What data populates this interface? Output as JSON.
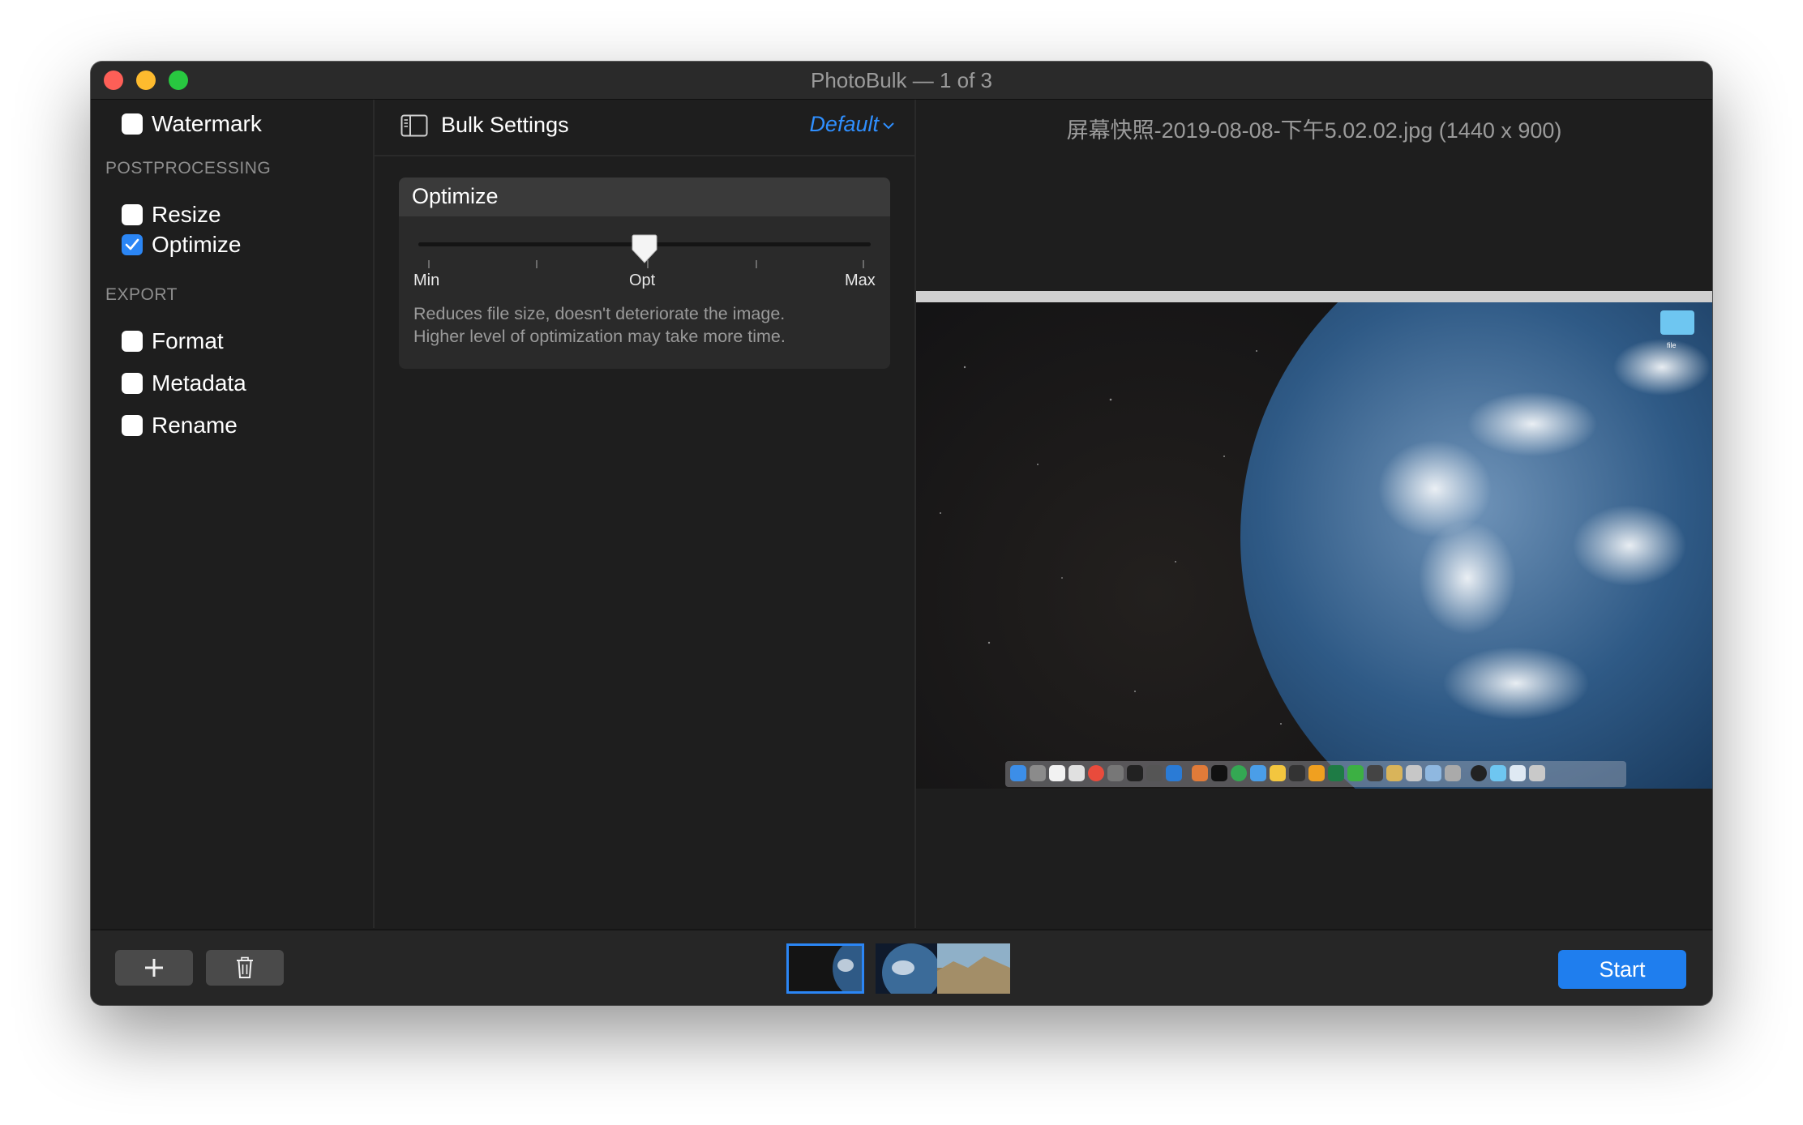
{
  "window": {
    "title": "PhotoBulk — 1 of 3"
  },
  "sidebar": {
    "items": [
      {
        "label": "Watermark",
        "checked": false
      },
      {
        "label": "Resize",
        "checked": false
      },
      {
        "label": "Optimize",
        "checked": true
      },
      {
        "label": "Format",
        "checked": false
      },
      {
        "label": "Metadata",
        "checked": false
      },
      {
        "label": "Rename",
        "checked": false
      }
    ],
    "sections": {
      "postprocessing": "POSTPROCESSING",
      "export": "EXPORT"
    }
  },
  "settings": {
    "title": "Bulk Settings",
    "preset": "Default",
    "optimize": {
      "title": "Optimize",
      "slider_labels": {
        "min": "Min",
        "opt": "Opt",
        "max": "Max"
      },
      "slider_value": 0.5,
      "description_line1": "Reduces file size, doesn't deteriorate the image.",
      "description_line2": "Higher level of optimization may take more time."
    }
  },
  "preview": {
    "filename": "屏幕快照-2019-08-08-下午5.02.02.jpg (1440 x 900)",
    "desktop_folder_label": "file"
  },
  "toolbar": {
    "add_icon": "plus-icon",
    "delete_icon": "trash-icon",
    "start_label": "Start"
  },
  "thumbnails": {
    "count": 3,
    "selected": 1
  },
  "colors": {
    "accent": "#1f7eee",
    "preset_link": "#2f8fff",
    "checkbox_checked": "#2b86f5"
  }
}
